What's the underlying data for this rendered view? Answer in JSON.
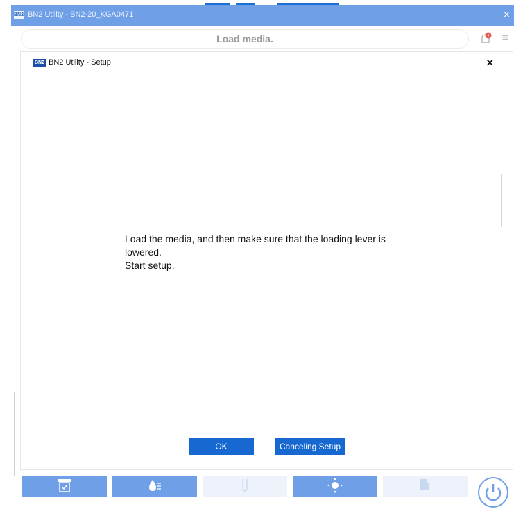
{
  "window": {
    "logo_text": "BN2",
    "title": "BN2 Utility - BN2-20_KGA0471",
    "minimize_glyph": "–",
    "close_glyph": "×"
  },
  "appbar": {
    "status_text": "Load media.",
    "notification_icon": "bell-icon",
    "notification_badge_color": "#e35b52",
    "menu_icon": "hamburger-icon",
    "menu_glyph": "≡"
  },
  "dialog": {
    "logo_text": "BN2",
    "title": "BN2 Utility - Setup",
    "close_glyph": "×",
    "message_lines": [
      "Load the media, and then make sure that the loading lever is",
      "lowered.",
      "Start setup."
    ],
    "ok_label": "OK",
    "cancel_label": "Canceling Setup"
  },
  "toolbar": {
    "items": [
      {
        "icon": "media-check-icon",
        "enabled": true
      },
      {
        "icon": "ink-drop-icon",
        "enabled": true
      },
      {
        "icon": "cleaning-icon",
        "enabled": false
      },
      {
        "icon": "adjust-icon",
        "enabled": true
      },
      {
        "icon": "cut-media-icon",
        "enabled": false
      }
    ],
    "power_icon": "power-icon"
  },
  "colors": {
    "accent": "#1769d1",
    "titlebar": "#6f9fe6",
    "toolbar_disabled": "#eef3fb"
  }
}
